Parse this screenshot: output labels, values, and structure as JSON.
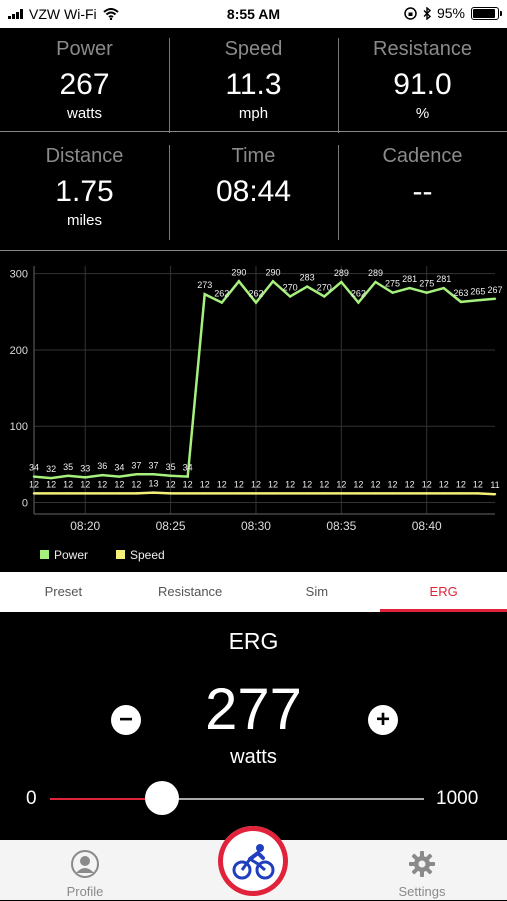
{
  "status_bar": {
    "carrier": "VZW Wi-Fi",
    "time": "8:55 AM",
    "battery": "95%"
  },
  "metrics_row1": [
    {
      "label": "Power",
      "value": "267",
      "unit": "watts"
    },
    {
      "label": "Speed",
      "value": "11.3",
      "unit": "mph"
    },
    {
      "label": "Resistance",
      "value": "91.0",
      "unit": "%"
    }
  ],
  "metrics_row2": [
    {
      "label": "Distance",
      "value": "1.75",
      "unit": "miles"
    },
    {
      "label": "Time",
      "value": "08:44",
      "unit": ""
    },
    {
      "label": "Cadence",
      "value": "--",
      "unit": ""
    }
  ],
  "chart_data": {
    "type": "line",
    "x": [
      "08:17",
      "08:18",
      "08:19",
      "08:20",
      "08:21",
      "08:22",
      "08:23",
      "08:24",
      "08:25",
      "08:26",
      "08:27",
      "08:28",
      "08:29",
      "08:30",
      "08:31",
      "08:32",
      "08:33",
      "08:34",
      "08:35",
      "08:36",
      "08:37",
      "08:38",
      "08:39",
      "08:40",
      "08:41",
      "08:42",
      "08:43",
      "08:44"
    ],
    "xticks": [
      "08:20",
      "08:25",
      "08:30",
      "08:35",
      "08:40"
    ],
    "ylim": [
      -15,
      310
    ],
    "yticks": [
      0,
      100,
      200,
      300
    ],
    "grid": true,
    "legend_position": "bottom-left",
    "series": [
      {
        "name": "Power",
        "color": "#a6f07e",
        "values": [
          34,
          32,
          35,
          33,
          36,
          34,
          37,
          37,
          35,
          34,
          273,
          262,
          290,
          262,
          290,
          270,
          283,
          270,
          289,
          262,
          289,
          275,
          281,
          275,
          281,
          263,
          265,
          267
        ],
        "labels": [
          "34",
          "32",
          "35",
          "33",
          "36",
          "34",
          "37",
          "37",
          "35",
          "34",
          "273",
          "262",
          "290",
          "262",
          "290",
          "270",
          "283",
          "270",
          "289",
          "262",
          "289",
          "275",
          "281",
          "275",
          "281",
          "263",
          "265",
          "267"
        ]
      },
      {
        "name": "Speed",
        "color": "#f4f07a",
        "values": [
          12,
          12,
          12,
          12,
          12,
          12,
          12,
          13,
          12,
          12,
          12,
          12,
          12,
          12,
          12,
          12,
          12,
          12,
          12,
          12,
          12,
          12,
          12,
          12,
          12,
          12,
          12,
          11
        ],
        "labels": [
          "12",
          "12",
          "12",
          "12",
          "12",
          "12",
          "12",
          "13",
          "12",
          "12",
          "12",
          "12",
          "12",
          "12",
          "12",
          "12",
          "12",
          "12",
          "12",
          "12",
          "12",
          "12",
          "12",
          "12",
          "12",
          "12",
          "12",
          "11"
        ]
      }
    ]
  },
  "tabs": [
    "Preset",
    "Resistance",
    "Sim",
    "ERG"
  ],
  "erg": {
    "title": "ERG",
    "value": "277",
    "unit": "watts",
    "minus_symbol": "−",
    "plus_symbol": "+",
    "slider_min": "0",
    "slider_max": "1000",
    "slider_level": 0.3
  },
  "tabbar": {
    "profile_label": "Profile",
    "settings_label": "Settings"
  },
  "colors": {
    "accent": "#e0233a",
    "power": "#a6f07e",
    "speed": "#f4f07a"
  },
  "icons": {
    "profile": "person-icon",
    "center": "cyclist-icon",
    "settings": "gear-icon"
  }
}
